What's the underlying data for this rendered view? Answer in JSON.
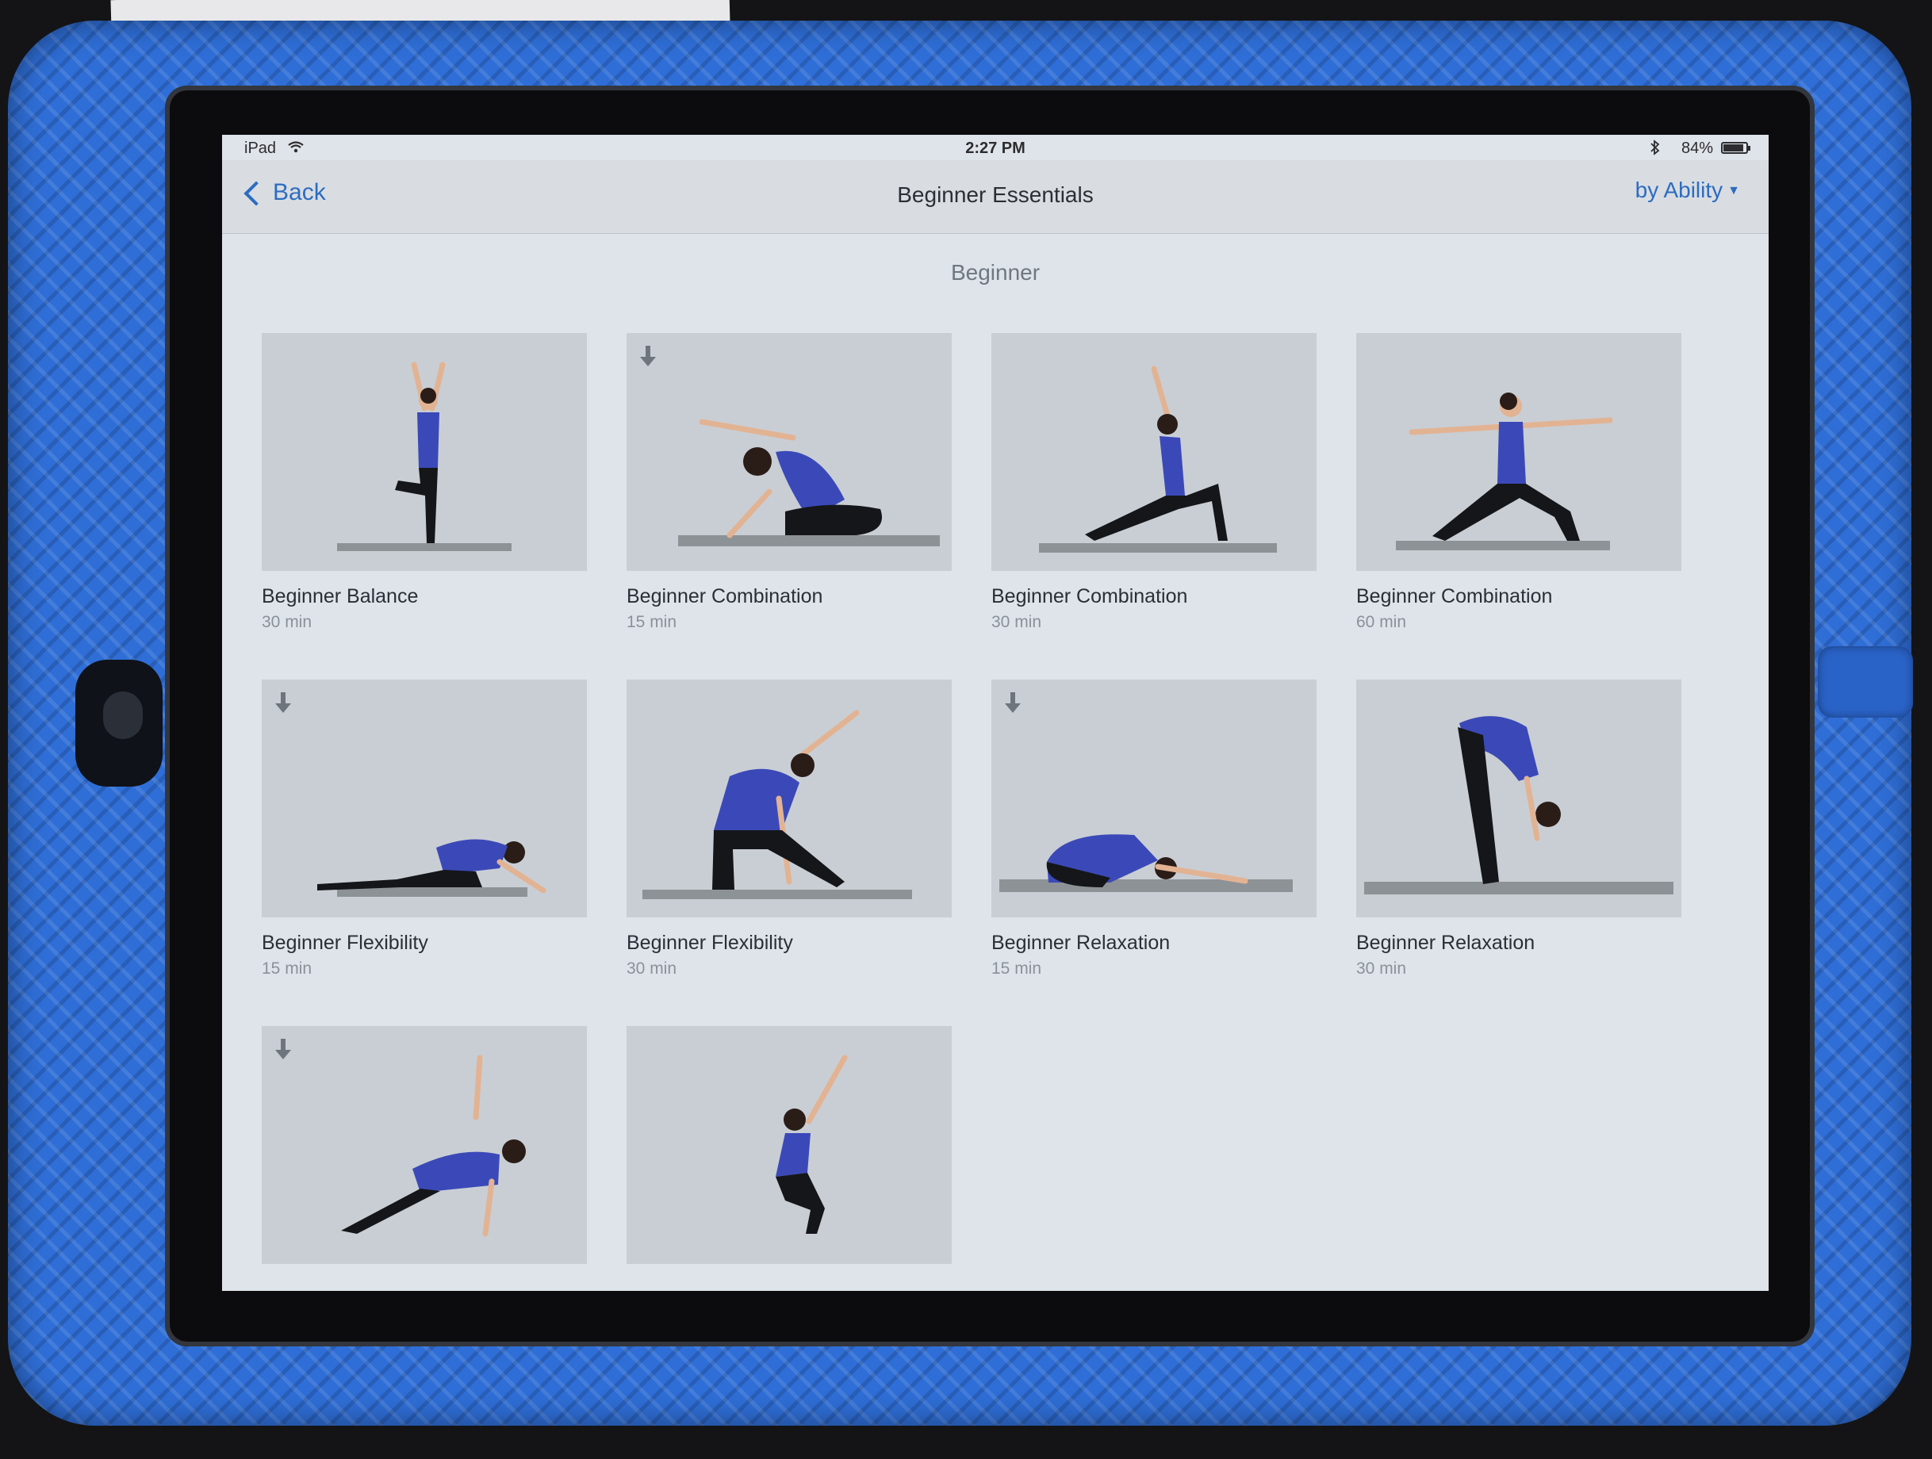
{
  "status_bar": {
    "device": "iPad",
    "time": "2:27 PM",
    "battery": "84%"
  },
  "nav": {
    "back_label": "Back",
    "title": "Beginner Essentials",
    "sort_label": "by Ability"
  },
  "section": {
    "header": "Beginner"
  },
  "classes": [
    {
      "title": "Beginner Balance",
      "duration": "30 min",
      "downloaded": false,
      "pose": "tree"
    },
    {
      "title": "Beginner Combination",
      "duration": "15 min",
      "downloaded": true,
      "pose": "seated-side-bend"
    },
    {
      "title": "Beginner Combination",
      "duration": "30 min",
      "downloaded": false,
      "pose": "low-lunge"
    },
    {
      "title": "Beginner Combination",
      "duration": "60 min",
      "downloaded": false,
      "pose": "warrior-two"
    },
    {
      "title": "Beginner Flexibility",
      "duration": "15 min",
      "downloaded": true,
      "pose": "pigeon"
    },
    {
      "title": "Beginner Flexibility",
      "duration": "30 min",
      "downloaded": false,
      "pose": "gate"
    },
    {
      "title": "Beginner Relaxation",
      "duration": "15 min",
      "downloaded": true,
      "pose": "child"
    },
    {
      "title": "Beginner Relaxation",
      "duration": "30 min",
      "downloaded": false,
      "pose": "forward-fold"
    },
    {
      "title": "",
      "duration": "",
      "downloaded": true,
      "pose": "side-plank"
    },
    {
      "title": "",
      "duration": "",
      "downloaded": false,
      "pose": "chair-reach"
    }
  ],
  "colors": {
    "accent": "#2d6cc0",
    "top": "#3b49b8",
    "pants": "#15161a",
    "skin": "#e2b393",
    "mat": "#8d9297"
  }
}
